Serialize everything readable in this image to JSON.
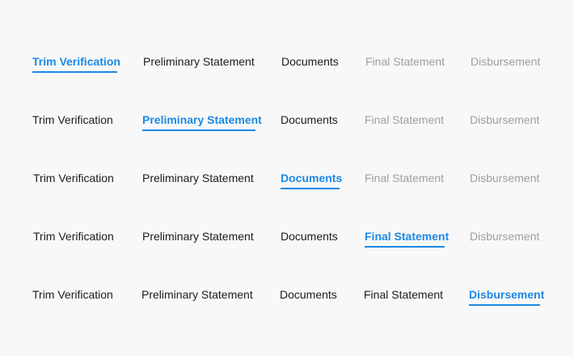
{
  "steppers": [
    {
      "tabs": [
        {
          "label": "Trim Verification",
          "state": "active"
        },
        {
          "label": "Preliminary Statement",
          "state": "default"
        },
        {
          "label": "Documents",
          "state": "default"
        },
        {
          "label": "Final Statement",
          "state": "disabled"
        },
        {
          "label": "Disbursement",
          "state": "disabled"
        }
      ]
    },
    {
      "tabs": [
        {
          "label": "Trim Verification",
          "state": "default"
        },
        {
          "label": "Preliminary Statement",
          "state": "active"
        },
        {
          "label": "Documents",
          "state": "default"
        },
        {
          "label": "Final Statement",
          "state": "disabled"
        },
        {
          "label": "Disbursement",
          "state": "disabled"
        }
      ]
    },
    {
      "tabs": [
        {
          "label": "Trim Verification",
          "state": "default"
        },
        {
          "label": "Preliminary Statement",
          "state": "default"
        },
        {
          "label": "Documents",
          "state": "active"
        },
        {
          "label": "Final Statement",
          "state": "disabled"
        },
        {
          "label": "Disbursement",
          "state": "disabled"
        }
      ]
    },
    {
      "tabs": [
        {
          "label": "Trim Verification",
          "state": "default"
        },
        {
          "label": "Preliminary Statement",
          "state": "default"
        },
        {
          "label": "Documents",
          "state": "default"
        },
        {
          "label": "Final Statement",
          "state": "active"
        },
        {
          "label": "Disbursement",
          "state": "disabled"
        }
      ]
    },
    {
      "tabs": [
        {
          "label": "Trim Verification",
          "state": "default"
        },
        {
          "label": "Preliminary Statement",
          "state": "default"
        },
        {
          "label": "Documents",
          "state": "default"
        },
        {
          "label": "Final Statement",
          "state": "default"
        },
        {
          "label": "Disbursement",
          "state": "active"
        }
      ]
    }
  ],
  "colors": {
    "active": "#1e88e5",
    "default": "#1c1c1c",
    "disabled": "#9e9e9e",
    "background": "#f8f8f8"
  }
}
